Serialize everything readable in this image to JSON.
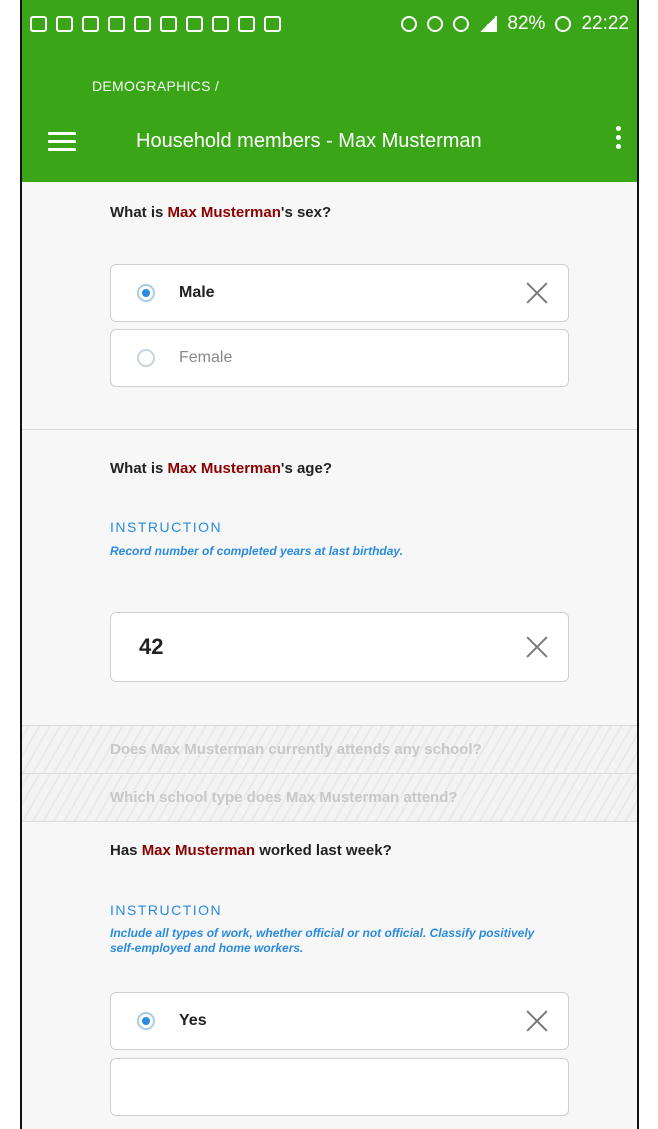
{
  "statusbar": {
    "battery": "82%",
    "time": "22:22"
  },
  "appbar": {
    "breadcrumb": "DEMOGRAPHICS /",
    "title": "Household members - Max Musterman"
  },
  "q_sex": {
    "title_pre": "What is ",
    "title_name": "Max Musterman",
    "title_post": "'s sex?",
    "options": [
      {
        "label": "Male",
        "selected": true
      },
      {
        "label": "Female",
        "selected": false
      }
    ]
  },
  "q_age": {
    "title_pre": "What is ",
    "title_name": "Max Musterman",
    "title_post": "'s age?",
    "instruction_label": "INSTRUCTION",
    "instruction_text": "Record number of completed years at last birthday.",
    "value": "42"
  },
  "disabled_questions": [
    "Does Max Musterman currently attends any school?",
    "Which school type does Max Musterman attend?"
  ],
  "q_work": {
    "title_pre": "Has ",
    "title_name": "Max Musterman",
    "title_post": " worked last week?",
    "instruction_label": "INSTRUCTION",
    "instruction_text": "Include all types of work, whether official or not official. Classify positively self-employed and home workers.",
    "options": [
      {
        "label": "Yes",
        "selected": true
      }
    ]
  }
}
